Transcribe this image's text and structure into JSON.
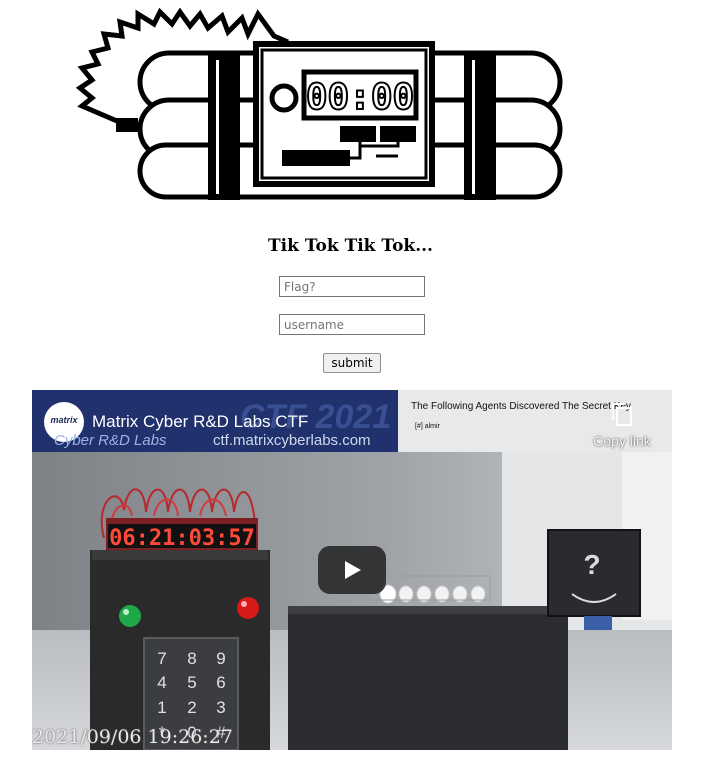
{
  "page": {
    "heading": "Tik Tok Tik Tok...",
    "logo": {
      "icon": "time-bomb-icon",
      "timer_display": "00:00"
    },
    "form": {
      "flag_placeholder": "Flag?",
      "username_placeholder": "username",
      "submit_label": "submit"
    }
  },
  "video": {
    "title": "Matrix Cyber R&D Labs CTF",
    "channel_logo": "matrix",
    "banner_text": "Cyber R&D Labs",
    "banner_url": "ctf.matrixcyberlabs.com",
    "banner_watermark": "CTF 2021",
    "overlay_caption": "The Following Agents Discovered The Secret Key",
    "agent": "[#] almir",
    "copy_link_label": "Copy link",
    "clock_display": "06:21:03:57",
    "keypad_keys": [
      "7",
      "8",
      "9",
      "4",
      "5",
      "6",
      "1",
      "2",
      "3",
      "*",
      "0",
      "#"
    ],
    "mystery_symbol": "?",
    "timestamp": "2021/09/06 19:26:27",
    "colors": {
      "led_green": "#1fa84a",
      "led_red": "#d61a1a",
      "clock_segment": "#ff4a3a",
      "play_button": "#212121"
    }
  }
}
